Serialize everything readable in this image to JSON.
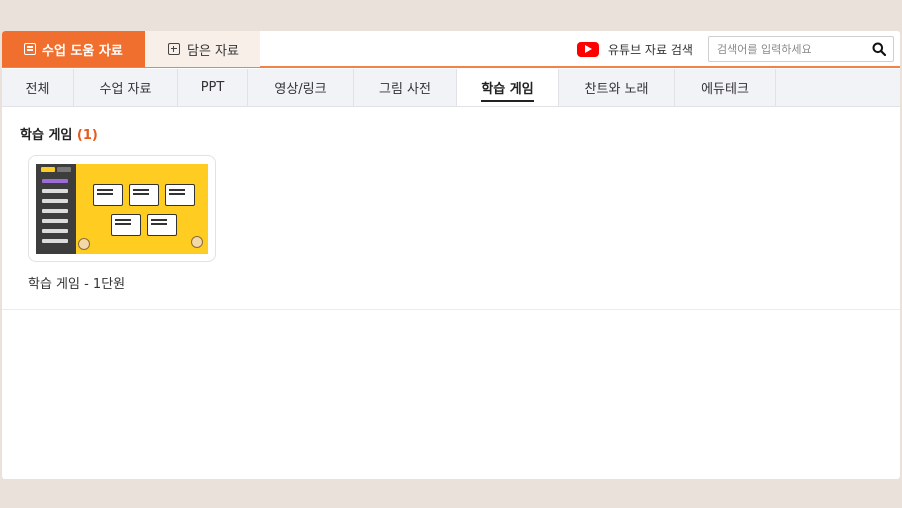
{
  "header": {
    "tab_main_label": "수업 도움 자료",
    "tab_saved_label": "담은 자료",
    "youtube_label": "유튜브 자료 검색",
    "search_placeholder": "검색어를 입력하세요",
    "search_value": ""
  },
  "nav": {
    "items": [
      {
        "label": "전체"
      },
      {
        "label": "수업 자료"
      },
      {
        "label": "PPT"
      },
      {
        "label": "영상/링크"
      },
      {
        "label": "그림 사전"
      },
      {
        "label": "학습 게임"
      },
      {
        "label": "찬트와 노래"
      },
      {
        "label": "에듀테크"
      }
    ],
    "active_index": 5
  },
  "section": {
    "title": "학습 게임",
    "count": "(1)"
  },
  "cards": [
    {
      "title": "학습 게임 - 1단원"
    }
  ],
  "colors": {
    "accent": "#f16f2e",
    "count": "#e8591a",
    "thumb_bg": "#ffcc22",
    "youtube": "#ff0000"
  }
}
